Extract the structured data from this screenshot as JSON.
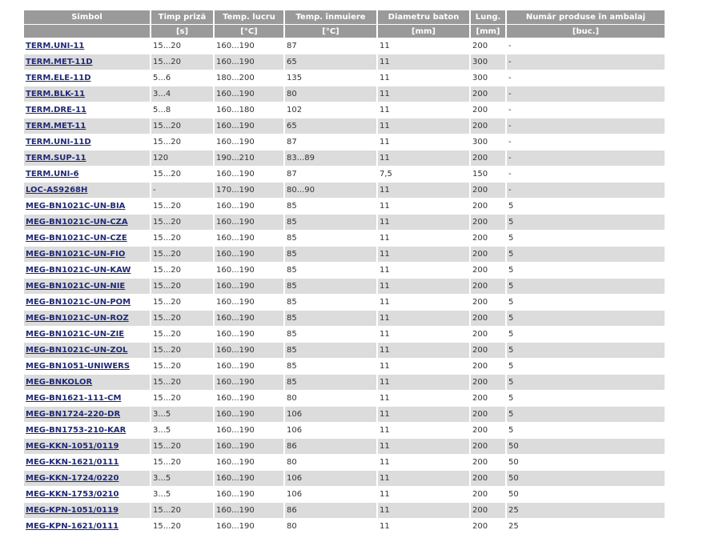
{
  "table": {
    "headers": [
      "Simbol",
      "Timp priză",
      "Temp. lucru",
      "Temp. înmuiere",
      "Diametru baton",
      "Lung.",
      "Număr produse în ambalaj"
    ],
    "units": [
      "",
      "[s]",
      "[°C]",
      "[°C]",
      "[mm]",
      "[mm]",
      "[buc.]"
    ],
    "rows": [
      [
        "TERM.UNI-11",
        "15...20",
        "160...190",
        "87",
        "11",
        "200",
        "-"
      ],
      [
        "TERM.MET-11D",
        "15...20",
        "160...190",
        "65",
        "11",
        "300",
        "-"
      ],
      [
        "TERM.ELE-11D",
        "5...6",
        "180...200",
        "135",
        "11",
        "300",
        "-"
      ],
      [
        "TERM.BLK-11",
        "3...4",
        "160...190",
        "80",
        "11",
        "200",
        "-"
      ],
      [
        "TERM.DRE-11",
        "5...8",
        "160...180",
        "102",
        "11",
        "200",
        "-"
      ],
      [
        "TERM.MET-11",
        "15...20",
        "160...190",
        "65",
        "11",
        "200",
        "-"
      ],
      [
        "TERM.UNI-11D",
        "15...20",
        "160...190",
        "87",
        "11",
        "300",
        "-"
      ],
      [
        "TERM.SUP-11",
        "120",
        "190...210",
        "83...89",
        "11",
        "200",
        "-"
      ],
      [
        "TERM.UNI-6",
        "15...20",
        "160...190",
        "87",
        "7,5",
        "150",
        "-"
      ],
      [
        "LOC-AS9268H",
        "-",
        "170...190",
        "80...90",
        "11",
        "200",
        "-"
      ],
      [
        "MEG-BN1021C-UN-BIA",
        "15...20",
        "160...190",
        "85",
        "11",
        "200",
        "5"
      ],
      [
        "MEG-BN1021C-UN-CZA",
        "15...20",
        "160...190",
        "85",
        "11",
        "200",
        "5"
      ],
      [
        "MEG-BN1021C-UN-CZE",
        "15...20",
        "160...190",
        "85",
        "11",
        "200",
        "5"
      ],
      [
        "MEG-BN1021C-UN-FIO",
        "15...20",
        "160...190",
        "85",
        "11",
        "200",
        "5"
      ],
      [
        "MEG-BN1021C-UN-KAW",
        "15...20",
        "160...190",
        "85",
        "11",
        "200",
        "5"
      ],
      [
        "MEG-BN1021C-UN-NIE",
        "15...20",
        "160...190",
        "85",
        "11",
        "200",
        "5"
      ],
      [
        "MEG-BN1021C-UN-POM",
        "15...20",
        "160...190",
        "85",
        "11",
        "200",
        "5"
      ],
      [
        "MEG-BN1021C-UN-ROZ",
        "15...20",
        "160...190",
        "85",
        "11",
        "200",
        "5"
      ],
      [
        "MEG-BN1021C-UN-ZIE",
        "15...20",
        "160...190",
        "85",
        "11",
        "200",
        "5"
      ],
      [
        "MEG-BN1021C-UN-ZOL",
        "15...20",
        "160...190",
        "85",
        "11",
        "200",
        "5"
      ],
      [
        "MEG-BN1051-UNIWERS",
        "15...20",
        "160...190",
        "85",
        "11",
        "200",
        "5"
      ],
      [
        "MEG-BNKOLOR",
        "15...20",
        "160...190",
        "85",
        "11",
        "200",
        "5"
      ],
      [
        "MEG-BN1621-111-CM",
        "15...20",
        "160...190",
        "80",
        "11",
        "200",
        "5"
      ],
      [
        "MEG-BN1724-220-DR",
        "3...5",
        "160...190",
        "106",
        "11",
        "200",
        "5"
      ],
      [
        "MEG-BN1753-210-KAR",
        "3...5",
        "160...190",
        "106",
        "11",
        "200",
        "5"
      ],
      [
        "MEG-KKN-1051/0119",
        "15...20",
        "160...190",
        "86",
        "11",
        "200",
        "50"
      ],
      [
        "MEG-KKN-1621/0111",
        "15...20",
        "160...190",
        "80",
        "11",
        "200",
        "50"
      ],
      [
        "MEG-KKN-1724/0220",
        "3...5",
        "160...190",
        "106",
        "11",
        "200",
        "50"
      ],
      [
        "MEG-KKN-1753/0210",
        "3...5",
        "160...190",
        "106",
        "11",
        "200",
        "50"
      ],
      [
        "MEG-KPN-1051/0119",
        "15...20",
        "160...190",
        "86",
        "11",
        "200",
        "25"
      ],
      [
        "MEG-KPN-1621/0111",
        "15...20",
        "160...190",
        "80",
        "11",
        "200",
        "25"
      ]
    ]
  },
  "colors": {
    "header_bg": "#9a9a9a",
    "stripe_bg": "#dcdcdc",
    "link": "#1f2a7a"
  }
}
